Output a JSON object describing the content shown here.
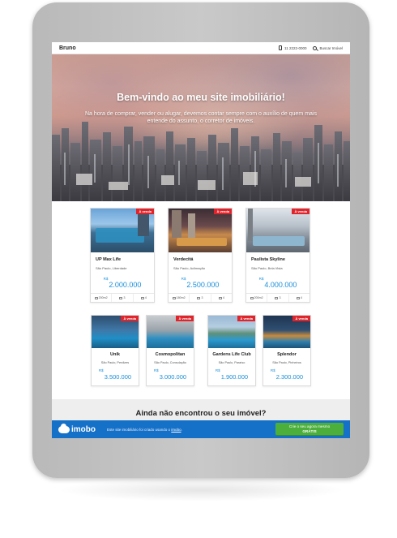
{
  "header": {
    "brand": "Bruno",
    "phone": "11 2222-0000",
    "search_label": "Buscar Imóvel"
  },
  "hero": {
    "title": "Bem-vindo ao meu site imobiliário!",
    "subtitle": "Na hora de comprar, vender ou alugar, devemos contar sempre com o auxílio de quem mais entende do assunto, o corretor de imóveis."
  },
  "listings_top": [
    {
      "badge": "À venda",
      "name": "UP Max Life",
      "location": "São Paulo, Liberdade",
      "currency": "R$",
      "price": "2.000.000",
      "area": "200m2",
      "rooms": "3",
      "parking": "4"
    },
    {
      "badge": "À venda",
      "name": "Verdecitá",
      "location": "São Paulo, Aclimação",
      "currency": "R$",
      "price": "2.500.000",
      "area": "180m2",
      "rooms": "3",
      "parking": "4"
    },
    {
      "badge": "À venda",
      "name": "Paulista Skyline",
      "location": "São Paulo, Bela Vista",
      "currency": "R$",
      "price": "4.000.000",
      "area": "200m2",
      "rooms": "3",
      "parking": "4"
    }
  ],
  "listings_bottom": [
    {
      "badge": "À venda",
      "name": "Unik",
      "location": "São Paulo, Perdizes",
      "currency": "R$",
      "price": "3.500.000"
    },
    {
      "badge": "À venda",
      "name": "Cosmopolitan",
      "location": "São Paulo, Consolação",
      "currency": "R$",
      "price": "3.000.000"
    },
    {
      "badge": "À venda",
      "name": "Gardens Life Club",
      "location": "São Paulo, Paraíso",
      "currency": "R$",
      "price": "1.900.000"
    },
    {
      "badge": "À venda",
      "name": "Splendor",
      "location": "São Paulo, Pinheiros",
      "currency": "R$",
      "price": "2.300.000"
    }
  ],
  "cta": {
    "question": "Ainda não encontrou o seu imóvel?"
  },
  "footer": {
    "logo": "imobo",
    "text_prefix": "Este site imobiliário foi criado usando o",
    "text_link": "imobo",
    "button_line1": "Crie o seu agora mesmo",
    "button_line2": "GRÁTIS"
  },
  "colors": {
    "accent_blue": "#1570c8",
    "price_blue": "#1a8fd8",
    "badge_red": "#e0242b",
    "button_green": "#4caf3c"
  }
}
